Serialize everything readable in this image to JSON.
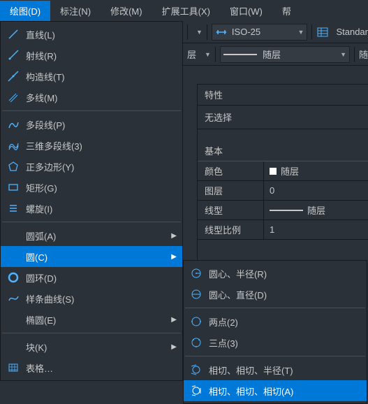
{
  "menubar": {
    "items": [
      {
        "label": "绘图(D)",
        "active": true
      },
      {
        "label": "标注(N)"
      },
      {
        "label": "修改(M)"
      },
      {
        "label": "扩展工具(X)"
      },
      {
        "label": "窗口(W)"
      },
      {
        "label": "帮"
      }
    ]
  },
  "menu": {
    "line": "直线(L)",
    "ray": "射线(R)",
    "xline": "构造线(T)",
    "mline": "多线(M)",
    "pline": "多段线(P)",
    "pline3d": "三维多段线(3)",
    "polygon": "正多边形(Y)",
    "rect": "矩形(G)",
    "spiral": "螺旋(I)",
    "arc": "圆弧(A)",
    "circle": "圆(C)",
    "donut": "圆环(D)",
    "spline": "样条曲线(S)",
    "ellipse": "椭圆(E)",
    "block": "块(K)",
    "table": "表格…"
  },
  "submenu": {
    "cr": "圆心、半径(R)",
    "cd": "圆心、直径(D)",
    "p2": "两点(2)",
    "p3": "三点(3)",
    "ttr": "相切、相切、半径(T)",
    "ttt": "相切、相切、相切(A)"
  },
  "toolbar": {
    "dimstyle": "ISO-25",
    "standard": "Standar",
    "layer_combo": "层",
    "bylayer": "随层",
    "by": "随"
  },
  "panel": {
    "title": "特性",
    "noselect": "无选择",
    "section_basic": "基本",
    "props": {
      "color_k": "颜色",
      "color_v": "随层",
      "layer_k": "图层",
      "layer_v": "0",
      "ltype_k": "线型",
      "ltype_v": "随层",
      "ltscale_k": "线型比例",
      "ltscale_v": "1"
    }
  }
}
